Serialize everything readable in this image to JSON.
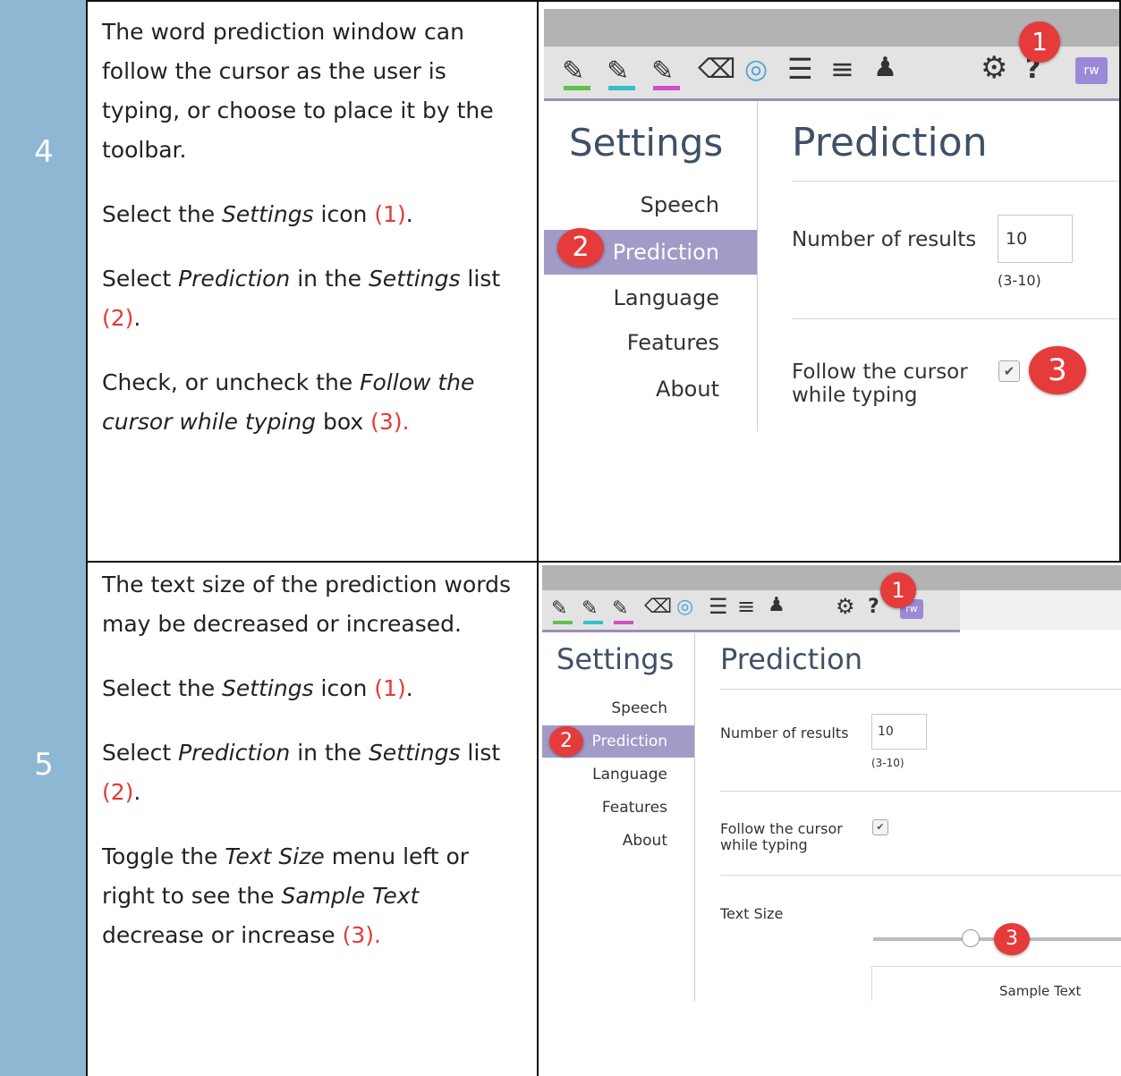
{
  "rows": [
    {
      "number": "4",
      "text": {
        "intro": "The word prediction window can follow the cursor as the user is typing, or choose to place it by the toolbar.",
        "step1_a": "Select the ",
        "step1_em": "Settings",
        "step1_b": " icon ",
        "step1_ref": "(1)",
        "step1_end": ".",
        "step2_a": "Select ",
        "step2_em": "Prediction",
        "step2_b": " in the ",
        "step2_em2": "Settings",
        "step2_c": " list ",
        "step2_ref": "(2)",
        "step2_end": ".",
        "step3_a": "Check, or uncheck the ",
        "step3_em": "Follow the cursor while typing",
        "step3_b": " box ",
        "step3_ref": "(3)."
      }
    },
    {
      "number": "5",
      "text": {
        "intro": "The text size of the prediction words may be decreased or increased.",
        "step1_a": "Select the ",
        "step1_em": "Settings",
        "step1_b": " icon ",
        "step1_ref": "(1)",
        "step1_end": ".",
        "step2_a": "Select ",
        "step2_em": "Prediction",
        "step2_b": " in the ",
        "step2_em2": "Settings",
        "step2_c": " list ",
        "step2_ref": "(2)",
        "step2_end": ".",
        "step3_a": "Toggle the ",
        "step3_em": "Text Size",
        "step3_b": " menu left or right to see the ",
        "step3_em2": "Sample Text",
        "step3_c": " decrease or increase ",
        "step3_ref": "(3)."
      }
    }
  ],
  "screenshot": {
    "settings_title": "Settings",
    "nav": [
      "Speech",
      "Prediction",
      "Language",
      "Features",
      "About"
    ],
    "panel_title": "Prediction",
    "number_of_results_label": "Number of results",
    "number_of_results_value": "10",
    "number_of_results_range": "(3-10)",
    "follow_cursor_label_1": "Follow the cursor",
    "follow_cursor_label_2": "while typing",
    "checkbox_mark": "✔",
    "text_size_label": "Text Size",
    "sample_text": "Sample Text",
    "app_badge": "rw",
    "text_size_level": 0.5
  },
  "badges": [
    "1",
    "2",
    "3"
  ],
  "colors": {
    "number_column": "#8eb7d3",
    "reference_red": "#e53935",
    "badge_red": "#e53b3b",
    "nav_active": "#a29ac7",
    "heading_slate": "#3f5066"
  },
  "toolbar_icons": [
    "highlighter-green-icon",
    "highlighter-cyan-icon",
    "highlighter-pink-icon",
    "eraser-icon",
    "collect-highlights-icon",
    "list-icon",
    "sort-list-icon",
    "vocabulary-icon",
    "gear-icon",
    "help-icon",
    "extension-icon"
  ]
}
